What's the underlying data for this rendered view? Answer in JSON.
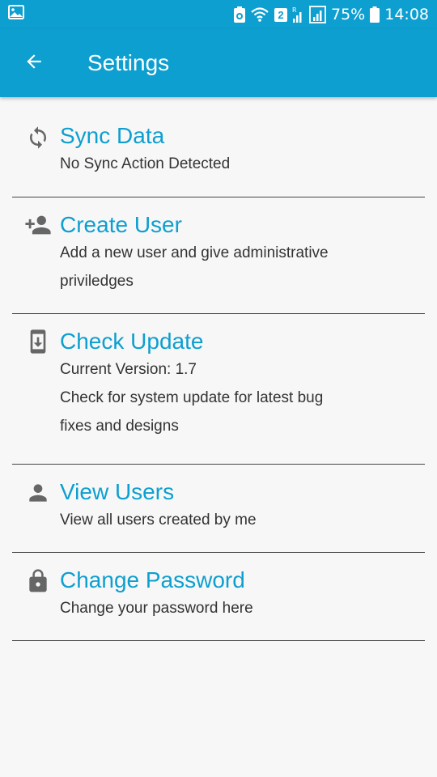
{
  "status_bar": {
    "battery_percent": "75%",
    "time": "14:08",
    "sim_badge": "2",
    "icons": [
      "gallery-icon",
      "battery-saver-icon",
      "wifi-icon",
      "sim-badge-icon",
      "signal-icon",
      "battery-icon"
    ]
  },
  "app_bar": {
    "title": "Settings",
    "back_icon": "arrow-back-icon"
  },
  "colors": {
    "primary": "#0d9fd0",
    "title_text": "#0d9fd0",
    "body_text": "#333333",
    "background": "#f7f7f7",
    "icon": "#666666"
  },
  "settings": [
    {
      "icon": "sync-icon",
      "title": "Sync Data",
      "lines": [
        "No Sync Action Detected"
      ]
    },
    {
      "icon": "person-add-icon",
      "title": "Create User",
      "lines": [
        "Add a new user and give administrative",
        "priviledges"
      ]
    },
    {
      "icon": "system-update-icon",
      "title": "Check Update",
      "lines": [
        "Current Version: 1.7",
        "Check for system update for latest bug",
        "fixes and designs"
      ]
    },
    {
      "icon": "person-icon",
      "title": "View Users",
      "lines": [
        "View all users created by me"
      ]
    },
    {
      "icon": "lock-icon",
      "title": "Change Password",
      "lines": [
        "Change your password here"
      ]
    }
  ]
}
